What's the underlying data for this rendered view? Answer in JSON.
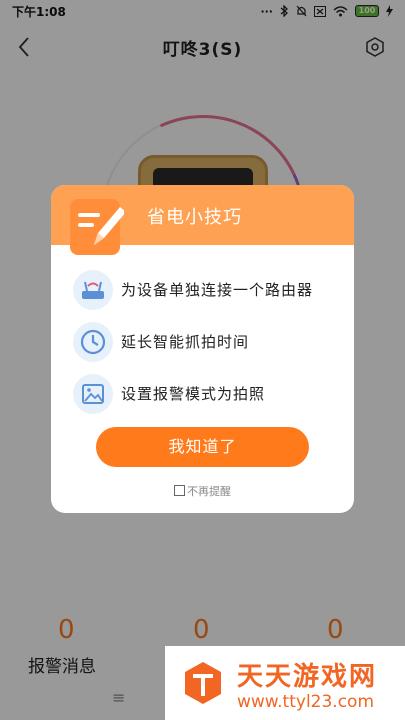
{
  "status_bar": {
    "time": "下午1:08",
    "icons": [
      "more-icon",
      "bluetooth-icon",
      "bell-muted-icon",
      "close-box-icon",
      "wifi-icon",
      "battery-icon",
      "charging-icon"
    ],
    "battery_level": "100"
  },
  "header": {
    "title": "叮咚3(S)"
  },
  "stats": [
    {
      "value": "0",
      "label": "报警消息"
    },
    {
      "value": "0",
      "label": ""
    },
    {
      "value": "0",
      "label": ""
    }
  ],
  "bottom": {
    "menu_glyph": "≡"
  },
  "dialog": {
    "title": "省电小技巧",
    "tips": [
      {
        "icon": "router-icon",
        "text": "为设备单独连接一个路由器"
      },
      {
        "icon": "clock-icon",
        "text": "延长智能抓拍时间"
      },
      {
        "icon": "image-icon",
        "text": "设置报警模式为拍照"
      }
    ],
    "confirm_label": "我知道了",
    "dont_remind_label": "不再提醒"
  },
  "watermark": {
    "title": "天天游戏网",
    "url": "www.ttyl23.com"
  },
  "colors": {
    "accent": "#ff7a1a",
    "dialog_header": "#ffa152",
    "tip_icon_bg": "#e6f1fb",
    "watermark": "#f26522"
  }
}
